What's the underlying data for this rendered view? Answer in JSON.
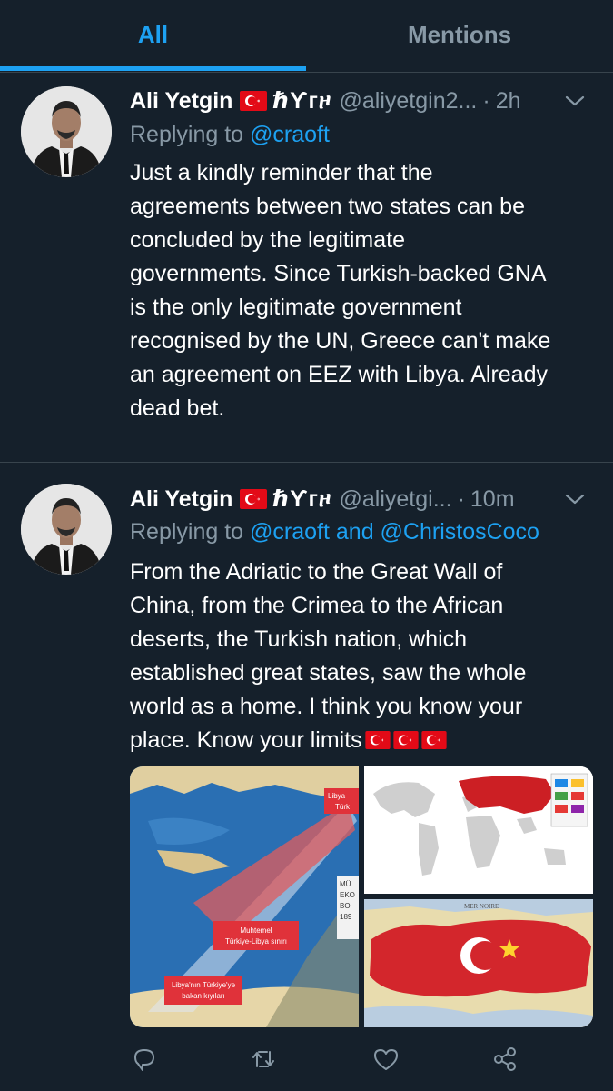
{
  "tabs": {
    "all": "All",
    "mentions": "Mentions"
  },
  "colors": {
    "background": "#15202b",
    "accent": "#1da1f2",
    "muted": "#8899a6",
    "divider": "#38444d",
    "flag_red": "#e30a17"
  },
  "tweets": [
    {
      "name": "Ali Yetgin",
      "script": "ℏϒᴦዞ",
      "handle": "@aliyetgin2...",
      "separator": "·",
      "time": "2h",
      "replying_prefix": "Replying to",
      "replying_to": "@craoft",
      "body": "Just a kindly reminder that the\nagreements between two states can be\nconcluded by the legitimate\ngovernments. Since Turkish-backed GNA\nis the only legitimate government\nrecognised by the UN, Greece can't make\nan agreement on EEZ with Libya. Already\ndead bet."
    },
    {
      "name": "Ali Yetgin",
      "script": "ℏϒᴦዞ",
      "handle": "@aliyetgi...",
      "separator": "·",
      "time": "10m",
      "replying_prefix": "Replying to",
      "replying_to": "@craoft and @ChristosCoco",
      "body": "From the Adriatic to the Great Wall of\nChina, from the Crimea to the African\ndeserts, the Turkish nation, which\nestablished great states, saw the whole\nworld as a home.  I think you know your\nplace.  Know your limits",
      "map_labels": {
        "libya_top": "Libya",
        "turk_top": "Türk",
        "muhtemel_1": "Muhtemel",
        "muhtemel_2": "Türkiye-Libya sınırı",
        "coast_1": "Libya'nın Türkiye'ye",
        "coast_2": "bakan kıyıları",
        "side_1": "MÜ",
        "side_2": "EKO",
        "side_3": "BO",
        "side_4": "189",
        "sea": "MER NOIRE"
      }
    }
  ],
  "icons": {
    "flag": "turkish-flag-icon",
    "chevron": "chevron-down-icon",
    "reply": "reply-icon",
    "retweet": "retweet-icon",
    "like": "heart-icon",
    "share": "share-icon"
  }
}
